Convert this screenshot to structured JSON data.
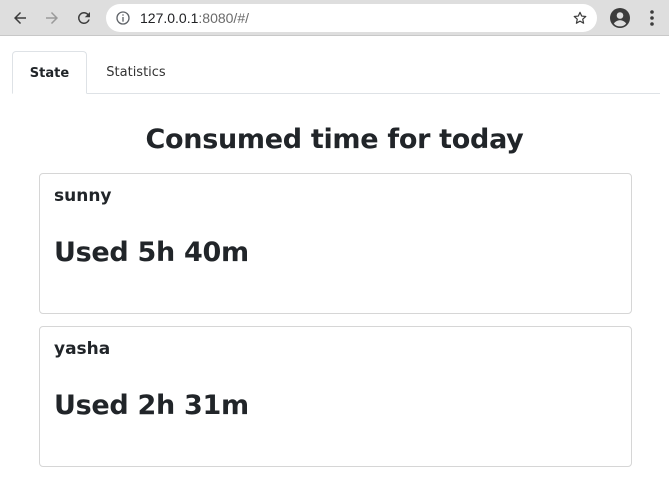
{
  "browser": {
    "url_host": "127.0.0.1",
    "url_rest": ":8080/#/",
    "icons": {
      "back": "arrow-left-icon",
      "forward": "arrow-right-icon",
      "reload": "reload-icon",
      "info": "info-icon",
      "star": "star-icon",
      "avatar": "account-icon",
      "menu": "more-vert-icon"
    }
  },
  "tabs": [
    {
      "label": "State",
      "active": true
    },
    {
      "label": "Statistics",
      "active": false
    }
  ],
  "main": {
    "heading": "Consumed time for today",
    "cards": [
      {
        "user": "sunny",
        "used": "Used 5h 40m"
      },
      {
        "user": "yasha",
        "used": "Used 2h 31m"
      }
    ]
  },
  "colors": {
    "chrome_bg": "#dedede",
    "text": "#212529",
    "border": "#dee2e6"
  }
}
